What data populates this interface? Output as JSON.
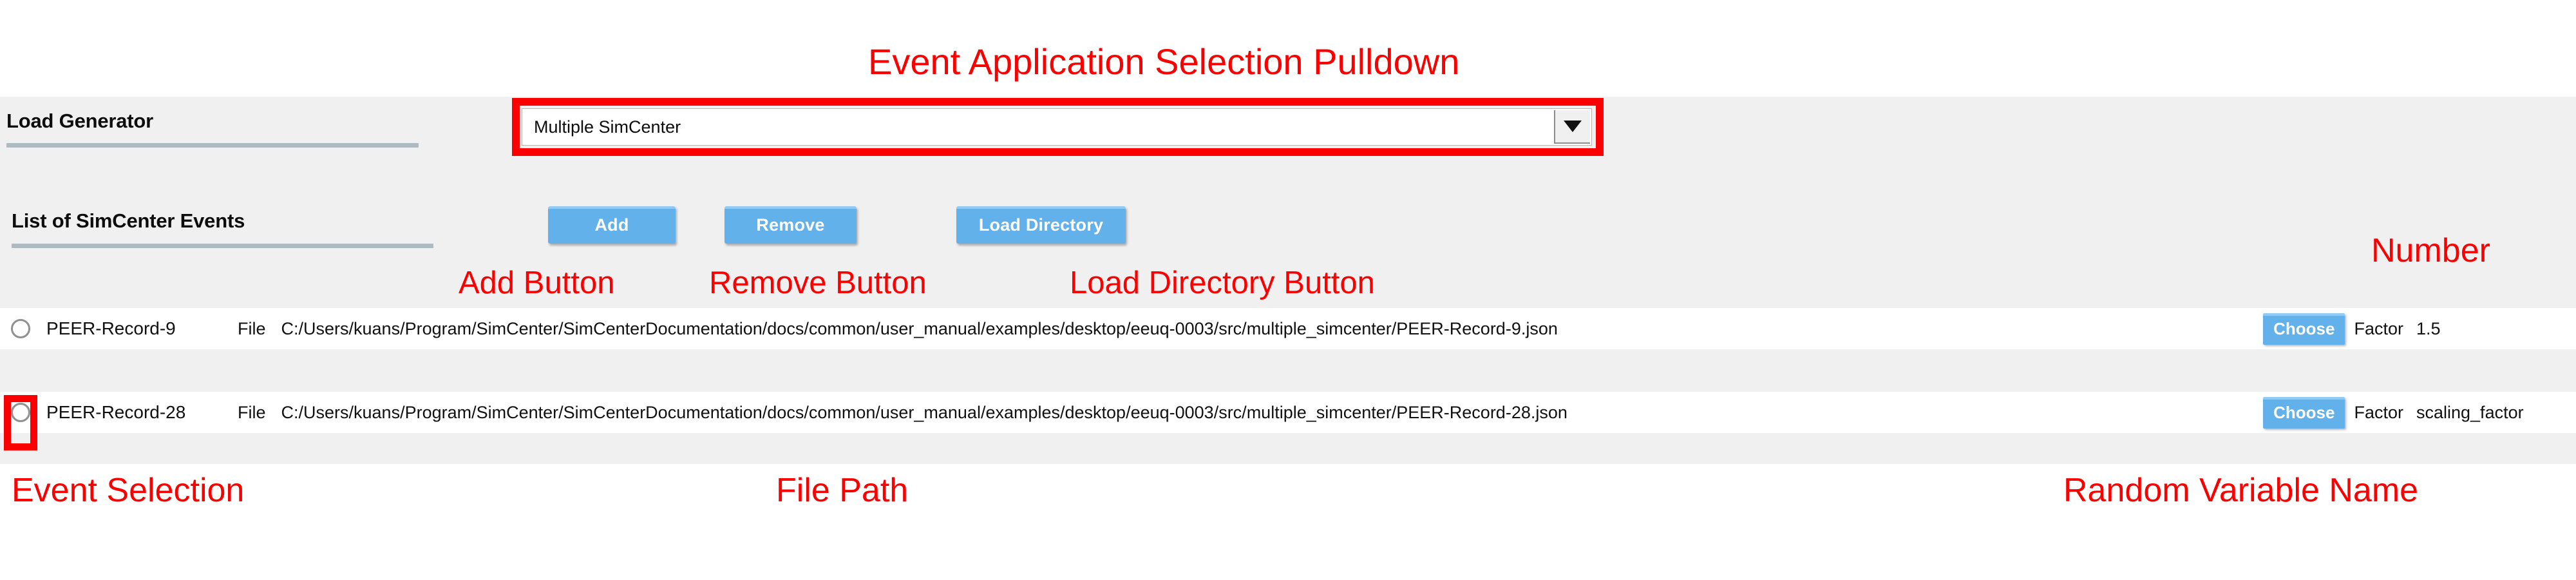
{
  "annotations": {
    "pulldown": "Event Application Selection Pulldown",
    "add_button": "Add Button",
    "remove_button": "Remove Button",
    "load_directory_button": "Load Directory Button",
    "number": "Number",
    "event_selection": "Event Selection",
    "file_path": "File Path",
    "random_variable_name": "Random Variable Name",
    "color": "#fa0000"
  },
  "panel": {
    "load_generator": {
      "label": "Load Generator",
      "combo_value": "Multiple SimCenter",
      "combo_arrow": "chevron-down-icon"
    },
    "events_section": {
      "label": "List of SimCenter Events",
      "buttons": {
        "add": "Add",
        "remove": "Remove",
        "load_directory": "Load Directory"
      }
    },
    "common": {
      "file_label": "File",
      "choose_label": "Choose",
      "factor_label": "Factor"
    },
    "events": [
      {
        "selected": false,
        "name": "PEER-Record-9",
        "path": "C:/Users/kuans/Program/SimCenter/SimCenterDocumentation/docs/common/user_manual/examples/desktop/eeuq-0003/src/multiple_simcenter/PEER-Record-9.json",
        "factor": "1.5",
        "highlighted": false
      },
      {
        "selected": false,
        "name": "PEER-Record-28",
        "path": "C:/Users/kuans/Program/SimCenter/SimCenterDocumentation/docs/common/user_manual/examples/desktop/eeuq-0003/src/multiple_simcenter/PEER-Record-28.json",
        "factor": "scaling_factor",
        "highlighted": true
      }
    ]
  },
  "colors": {
    "panel_background": "#f0f0f0",
    "row_background": "#ffffff",
    "button_blue": "#62b1ea",
    "underline": "#aebac2",
    "annotation_red": "#fa0000"
  }
}
